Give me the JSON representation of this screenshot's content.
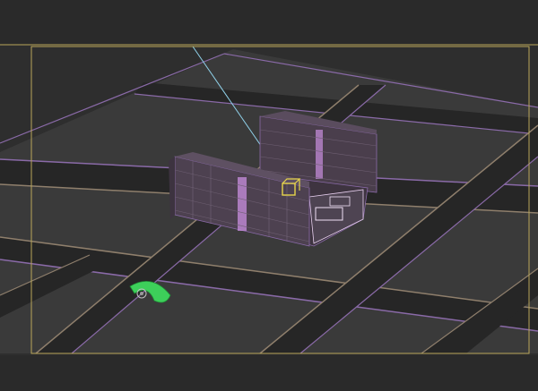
{
  "app": {
    "title": ""
  },
  "viewport": {
    "background": "#2e2e2e",
    "ground_color": "#3a3a3a",
    "road_color": "#252525",
    "road_edge_color": "#7a5a99",
    "curb_color": "#8f7f6c",
    "safe_frame_color": "#b9a75a",
    "camera_line_color": "#8fd0e8",
    "building_color": "#4a3e4c",
    "building_edge_color": "#d9a6e6",
    "selection_box_color": "#e6d44a",
    "tree_color": "#3dcf5a"
  },
  "objects": {
    "building_a": "tower",
    "building_b": "tower",
    "podium": "podium",
    "camera_target": "target",
    "tree_ring": "trees"
  }
}
